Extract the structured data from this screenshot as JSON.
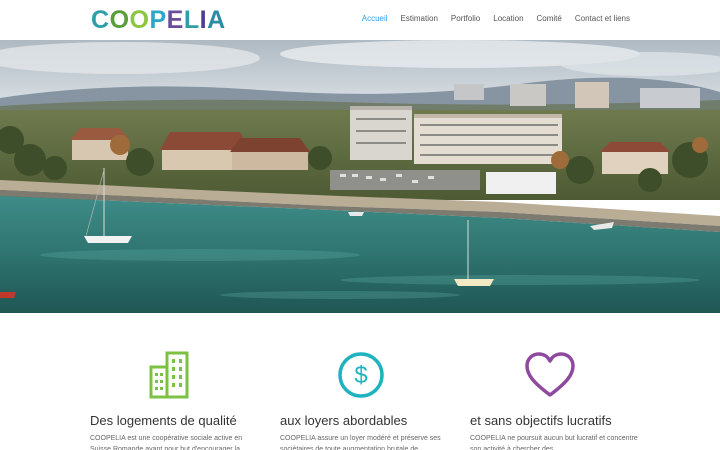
{
  "header": {
    "logo_text": "COOPELIA",
    "nav": [
      {
        "label": "Accueil",
        "active": true
      },
      {
        "label": "Estimation",
        "active": false
      },
      {
        "label": "Portfolio",
        "active": false
      },
      {
        "label": "Location",
        "active": false
      },
      {
        "label": "Comité",
        "active": false
      },
      {
        "label": "Contact et liens",
        "active": false
      }
    ],
    "accent_color": "#2ea3f2"
  },
  "hero": {
    "image_description": "aerial-lake-town-photo"
  },
  "features": [
    {
      "icon": "buildings-icon",
      "icon_color": "#7cc242",
      "title": "Des logements de qualité",
      "text": "COOPELIA est une coopérative sociale active en Suisse Romande ayant pour but d'encourager la"
    },
    {
      "icon": "dollar-icon",
      "icon_color": "#1fb3c0",
      "title": "aux loyers abordables",
      "text": "COOPELIA assure un loyer modéré et préserve ses sociétaires de toute augmentation brutale de"
    },
    {
      "icon": "heart-icon",
      "icon_color": "#8e4a9e",
      "title": "et sans objectifs lucratifs",
      "text": "COOPELIA ne poursuit aucun but lucratif et concentre son activité à chercher des"
    }
  ]
}
